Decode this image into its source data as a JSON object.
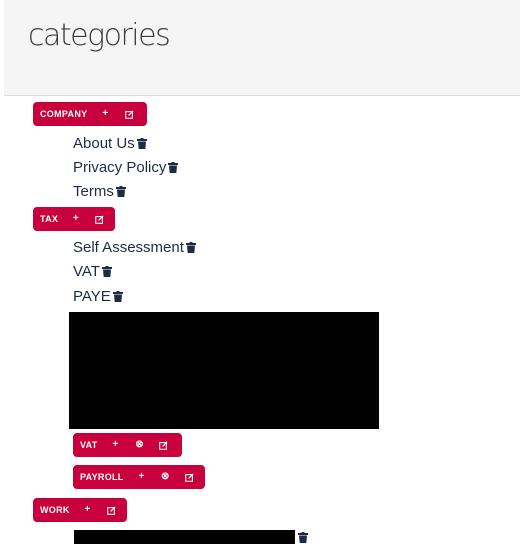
{
  "header": {
    "title": "categories"
  },
  "colors": {
    "accent": "#c8003c",
    "text": "#1f2a44",
    "header_bg": "#f5f5f5"
  },
  "icons": {
    "add": "plus-icon",
    "edit": "edit-icon",
    "remove": "remove-circle-icon",
    "delete": "trash-icon"
  },
  "categories": [
    {
      "label": "COMPANY",
      "items": [
        "About Us",
        "Privacy Policy",
        "Terms"
      ]
    },
    {
      "label": "TAX",
      "items": [
        "Self Assessment",
        "VAT",
        "PAYE"
      ],
      "subcategories": [
        {
          "label": "VAT"
        },
        {
          "label": "PAYROLL"
        }
      ]
    },
    {
      "label": "WORK"
    }
  ],
  "glyphs": {
    "plus": "+",
    "remove": "⊗"
  }
}
